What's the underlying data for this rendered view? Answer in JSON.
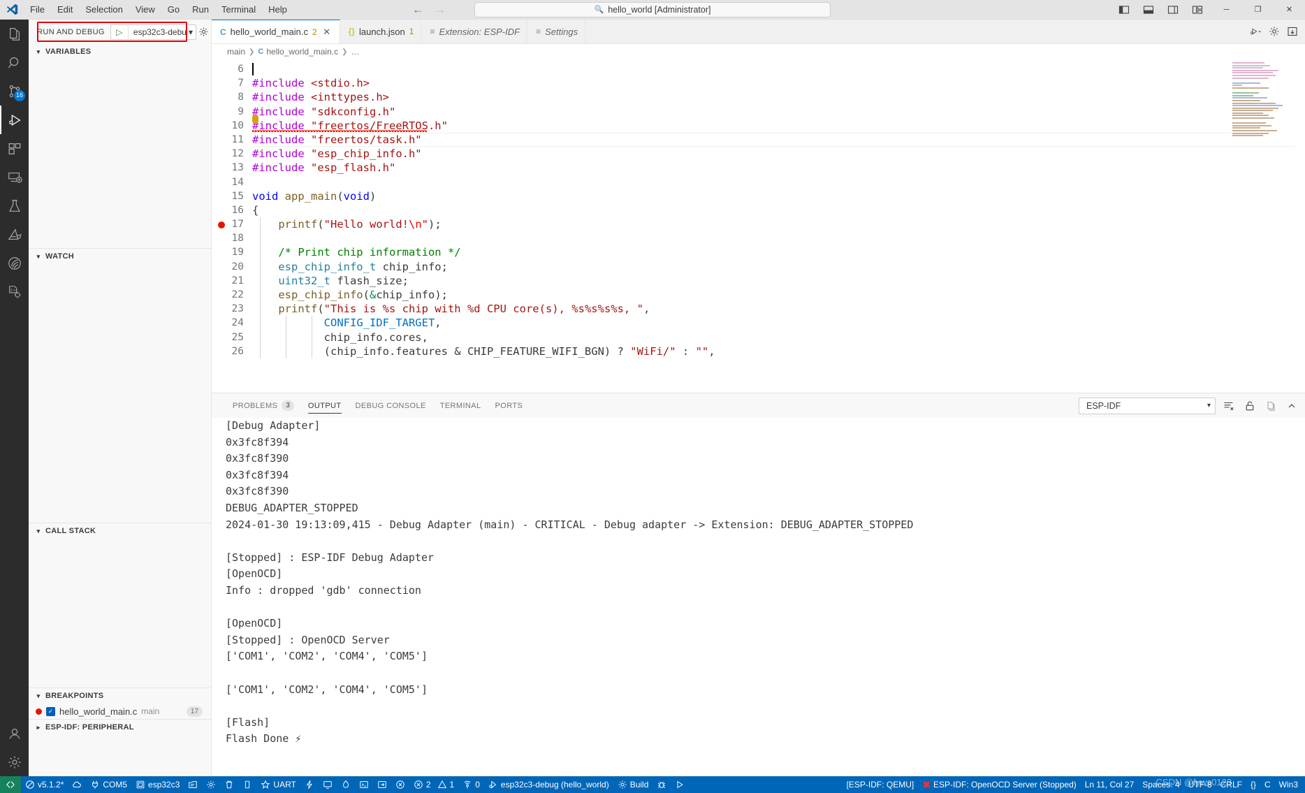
{
  "titlebar": {
    "menus": [
      "File",
      "Edit",
      "Selection",
      "View",
      "Go",
      "Run",
      "Terminal",
      "Help"
    ],
    "quick_input": "hello_world [Administrator]",
    "search_icon": "search-icon",
    "back_icon": "arrow-left-icon",
    "forward_icon": "arrow-right-icon",
    "layout_icons": [
      "toggle-primary-sidebar-icon",
      "toggle-panel-icon",
      "toggle-secondary-sidebar-icon",
      "customize-layout-icon"
    ],
    "window_controls": {
      "minimize": "─",
      "restore": "❐",
      "close": "✕"
    }
  },
  "activitybar": {
    "items": [
      {
        "name": "explorer",
        "icon": "files-icon",
        "badge": "",
        "active": false
      },
      {
        "name": "search",
        "icon": "search-icon",
        "badge": "",
        "active": false
      },
      {
        "name": "source-control",
        "icon": "source-control-icon",
        "badge": "16",
        "active": false
      },
      {
        "name": "run-and-debug",
        "icon": "run-debug-icon",
        "badge": "",
        "active": true
      },
      {
        "name": "extensions",
        "icon": "extensions-icon",
        "badge": "",
        "active": false
      },
      {
        "name": "remote-explorer",
        "icon": "remote-explorer-icon",
        "badge": "",
        "active": false
      },
      {
        "name": "testing",
        "icon": "beaker-icon",
        "badge": "",
        "active": false
      },
      {
        "name": "espressif-idf",
        "icon": "espressif-icon",
        "badge": "",
        "active": false
      },
      {
        "name": "wifi-provisioning",
        "icon": "wireless-icon",
        "badge": "",
        "active": false
      },
      {
        "name": "cpp-tools",
        "icon": "cpp-gear-icon",
        "badge": "",
        "active": false
      }
    ],
    "bottom_items": [
      {
        "name": "accounts",
        "icon": "account-icon"
      },
      {
        "name": "manage",
        "icon": "gear-icon"
      }
    ]
  },
  "sidebar": {
    "title": "RUN AND DEBUG",
    "launch_config": "esp32c3-debu",
    "start_debug_icon": "play-icon",
    "chevron_icon": "chevron-down-icon",
    "actions": [
      "open-launch-json-gear-icon",
      "more-actions-ellipsis-icon"
    ],
    "sections": [
      {
        "name": "variables",
        "label": "VARIABLES",
        "expanded": true
      },
      {
        "name": "watch",
        "label": "WATCH",
        "expanded": true
      },
      {
        "name": "call-stack",
        "label": "CALL STACK",
        "expanded": true
      },
      {
        "name": "breakpoints",
        "label": "BREAKPOINTS",
        "expanded": true
      },
      {
        "name": "esp-idf-peripheral",
        "label": "ESP-IDF: PERIPHERAL",
        "expanded": false
      }
    ],
    "breakpoints": [
      {
        "file": "hello_world_main.c",
        "function": "main",
        "line": "17",
        "enabled": true
      }
    ]
  },
  "tabs": [
    {
      "name": "hello_world_main.c",
      "label": "hello_world_main.c",
      "icon": "c-file-icon",
      "badge": "2",
      "active": true,
      "preview": false,
      "closable": true
    },
    {
      "name": "launch.json",
      "label": "launch.json",
      "icon": "json-file-icon",
      "badge": "1",
      "active": false,
      "preview": false,
      "closable": false
    },
    {
      "name": "Extension: ESP-IDF",
      "label": "Extension: ESP-IDF",
      "icon": "extension-page-icon",
      "badge": "",
      "active": false,
      "preview": true,
      "closable": false
    },
    {
      "name": "Settings",
      "label": "Settings",
      "icon": "settings-page-icon",
      "badge": "",
      "active": false,
      "preview": true,
      "closable": false
    }
  ],
  "tab_actions": [
    "run-and-debug-dropdown-icon",
    "settings-gear-icon",
    "split-editor-icon"
  ],
  "breadcrumbs": [
    {
      "label": "main",
      "icon": ""
    },
    {
      "label": "hello_world_main.c",
      "icon": "c-file-icon"
    },
    {
      "label": "…",
      "icon": ""
    }
  ],
  "editor": {
    "first_line_number": 6,
    "breakpoint_line": 17,
    "lines": [
      {
        "n": 6,
        "tokens": []
      },
      {
        "n": 7,
        "tokens": [
          {
            "t": "#include ",
            "c": "pre"
          },
          {
            "t": "<stdio.h>",
            "c": "str"
          }
        ]
      },
      {
        "n": 8,
        "tokens": [
          {
            "t": "#include ",
            "c": "pre"
          },
          {
            "t": "<inttypes.h>",
            "c": "str"
          }
        ]
      },
      {
        "n": 9,
        "tokens": [
          {
            "t": "#include ",
            "c": "pre"
          },
          {
            "t": "\"sdkconfig.h\"",
            "c": "str"
          }
        ]
      },
      {
        "n": 10,
        "tokens": [
          {
            "t": "#include ",
            "c": "pre"
          },
          {
            "t": "\"freertos/FreeRTOS.h\"",
            "c": "str"
          }
        ],
        "error": true,
        "lightbulb": true
      },
      {
        "n": 11,
        "tokens": [
          {
            "t": "#include ",
            "c": "pre"
          },
          {
            "t": "\"freertos/task.h\"",
            "c": "str"
          }
        ]
      },
      {
        "n": 12,
        "tokens": [
          {
            "t": "#include ",
            "c": "pre"
          },
          {
            "t": "\"esp_chip_info.h\"",
            "c": "str"
          }
        ]
      },
      {
        "n": 13,
        "tokens": [
          {
            "t": "#include ",
            "c": "pre"
          },
          {
            "t": "\"esp_flash.h\"",
            "c": "str"
          }
        ]
      },
      {
        "n": 14,
        "tokens": []
      },
      {
        "n": 15,
        "tokens": [
          {
            "t": "void ",
            "c": "kw"
          },
          {
            "t": "app_main",
            "c": "fn"
          },
          {
            "t": "(",
            "c": "pun"
          },
          {
            "t": "void",
            "c": "kw"
          },
          {
            "t": ")",
            "c": "pun"
          }
        ]
      },
      {
        "n": 16,
        "tokens": [
          {
            "t": "{",
            "c": "pun"
          }
        ]
      },
      {
        "n": 17,
        "tokens": [
          {
            "t": "    ",
            "c": "pun"
          },
          {
            "t": "printf",
            "c": "fn"
          },
          {
            "t": "(",
            "c": "pun"
          },
          {
            "t": "\"Hello world!",
            "c": "str"
          },
          {
            "t": "\\n",
            "c": "esc"
          },
          {
            "t": "\"",
            "c": "str"
          },
          {
            "t": ");",
            "c": "pun"
          }
        ]
      },
      {
        "n": 18,
        "tokens": []
      },
      {
        "n": 19,
        "tokens": [
          {
            "t": "    ",
            "c": "pun"
          },
          {
            "t": "/* Print chip information */",
            "c": "cmt"
          }
        ]
      },
      {
        "n": 20,
        "tokens": [
          {
            "t": "    ",
            "c": "pun"
          },
          {
            "t": "esp_chip_info_t",
            "c": "typ"
          },
          {
            "t": " chip_info;",
            "c": "pun"
          }
        ]
      },
      {
        "n": 21,
        "tokens": [
          {
            "t": "    ",
            "c": "pun"
          },
          {
            "t": "uint32_t",
            "c": "typ"
          },
          {
            "t": " flash_size;",
            "c": "pun"
          }
        ]
      },
      {
        "n": 22,
        "tokens": [
          {
            "t": "    ",
            "c": "pun"
          },
          {
            "t": "esp_chip_info",
            "c": "fn"
          },
          {
            "t": "(",
            "c": "pun"
          },
          {
            "t": "&",
            "c": "num"
          },
          {
            "t": "chip_info);",
            "c": "pun"
          }
        ]
      },
      {
        "n": 23,
        "tokens": [
          {
            "t": "    ",
            "c": "pun"
          },
          {
            "t": "printf",
            "c": "fn"
          },
          {
            "t": "(",
            "c": "pun"
          },
          {
            "t": "\"This is %s chip with %d CPU core(s), %s%s%s%s, \"",
            "c": "str"
          },
          {
            "t": ",",
            "c": "pun"
          }
        ]
      },
      {
        "n": 24,
        "tokens": [
          {
            "t": "           ",
            "c": "pun"
          },
          {
            "t": "CONFIG_IDF_TARGET",
            "c": "cst"
          },
          {
            "t": ",",
            "c": "pun"
          }
        ]
      },
      {
        "n": 25,
        "tokens": [
          {
            "t": "           ",
            "c": "pun"
          },
          {
            "t": "chip_info.cores,",
            "c": "pun"
          }
        ]
      },
      {
        "n": 26,
        "tokens": [
          {
            "t": "           ",
            "c": "pun"
          },
          {
            "t": "(chip_info.features & CHIP_FEATURE_WIFI_BGN) ? ",
            "c": "pun"
          },
          {
            "t": "\"WiFi/\"",
            "c": "str"
          },
          {
            "t": " : ",
            "c": "pun"
          },
          {
            "t": "\"\"",
            "c": "str"
          },
          {
            "t": ",",
            "c": "pun"
          }
        ]
      }
    ]
  },
  "panel": {
    "tabs": [
      {
        "name": "problems",
        "label": "PROBLEMS",
        "count": "3",
        "active": false
      },
      {
        "name": "output",
        "label": "OUTPUT",
        "count": "",
        "active": true
      },
      {
        "name": "debug-console",
        "label": "DEBUG CONSOLE",
        "count": "",
        "active": false
      },
      {
        "name": "terminal",
        "label": "TERMINAL",
        "count": "",
        "active": false
      },
      {
        "name": "ports",
        "label": "PORTS",
        "count": "",
        "active": false
      }
    ],
    "channel": "ESP-IDF",
    "actions": [
      "clear-output-icon",
      "unlock-scroll-icon",
      "open-in-editor-icon",
      "chevron-up-icon"
    ],
    "output_lines": [
      "[Debug Adapter]",
      "0x3fc8f394",
      "0x3fc8f390",
      "0x3fc8f394",
      "0x3fc8f390",
      "DEBUG_ADAPTER_STOPPED",
      "2024-01-30 19:13:09,415 - Debug Adapter (main) - CRITICAL - Debug adapter -> Extension: DEBUG_ADAPTER_STOPPED",
      "",
      "[Stopped] : ESP-IDF Debug Adapter",
      "[OpenOCD]",
      "Info : dropped 'gdb' connection",
      "",
      "[OpenOCD]",
      "[Stopped] : OpenOCD Server",
      "['COM1', 'COM2', 'COM4', 'COM5']",
      "",
      "['COM1', 'COM2', 'COM4', 'COM5']",
      "",
      "[Flash]",
      "Flash Done ⚡"
    ]
  },
  "statusbar": {
    "remote_icon": "remote-window-icon",
    "left_items": [
      {
        "name": "esp-idf-version",
        "label": "v5.1.2*",
        "icon": "circle-slash-icon"
      },
      {
        "name": "esp-idf-doc-search",
        "label": "",
        "icon": "cloud-download-icon"
      },
      {
        "name": "serial-port",
        "label": "COM5",
        "icon": "plug-icon"
      },
      {
        "name": "idf-target",
        "label": "esp32c3",
        "icon": "chip-icon"
      },
      {
        "name": "sdk-configuration-editor",
        "label": "",
        "icon": "menuconfig-icon"
      },
      {
        "name": "build-gear",
        "label": "",
        "icon": "gear-icon"
      },
      {
        "name": "full-clean",
        "label": "",
        "icon": "trash-icon"
      },
      {
        "name": "erase-flash",
        "label": "",
        "icon": "device-icon"
      },
      {
        "name": "flash-method-uart",
        "label": "UART",
        "icon": "star-icon"
      },
      {
        "name": "flash-device",
        "label": "",
        "icon": "lightning-icon"
      },
      {
        "name": "monitor-device",
        "label": "",
        "icon": "monitor-icon"
      },
      {
        "name": "idf-monitor",
        "label": "",
        "icon": "flame-icon"
      },
      {
        "name": "open-terminal",
        "label": "",
        "icon": "terminal-icon"
      },
      {
        "name": "idf-open",
        "label": "",
        "icon": "export-icon"
      },
      {
        "name": "disconnect",
        "label": "",
        "icon": "circle-x-icon"
      },
      {
        "name": "problems-count",
        "label": "2",
        "icon": "error-icon"
      },
      {
        "name": "warnings-count",
        "label": "1",
        "icon": "warning-icon"
      },
      {
        "name": "ports-count",
        "label": "0",
        "icon": "radio-tower-icon"
      },
      {
        "name": "debug-config",
        "label": "esp32c3-debug (hello_world)",
        "icon": "debug-alt-icon"
      },
      {
        "name": "build-task",
        "label": "Build",
        "icon": "gear-icon"
      },
      {
        "name": "debug-task",
        "label": "",
        "icon": "bug-icon"
      },
      {
        "name": "run-task",
        "label": "",
        "icon": "play-icon"
      }
    ],
    "right_items": [
      {
        "name": "esp-idf-qemu",
        "label": "[ESP-IDF: QEMU]",
        "icon": ""
      },
      {
        "name": "openocd-server-status",
        "label": "ESP-IDF: OpenOCD Server (Stopped)",
        "icon": "red-x-icon"
      },
      {
        "name": "editor-position",
        "label": "Ln 11, Col 27",
        "icon": ""
      },
      {
        "name": "indentation",
        "label": "Spaces: 4",
        "icon": ""
      },
      {
        "name": "encoding",
        "label": "UTF-8",
        "icon": ""
      },
      {
        "name": "eol",
        "label": "CRLF",
        "icon": ""
      },
      {
        "name": "bracket-pair",
        "label": "{}",
        "icon": ""
      },
      {
        "name": "language-mode",
        "label": "C",
        "icon": ""
      },
      {
        "name": "win32",
        "label": "Win3",
        "icon": ""
      }
    ],
    "watermark": "CSDN @fyws0123"
  }
}
